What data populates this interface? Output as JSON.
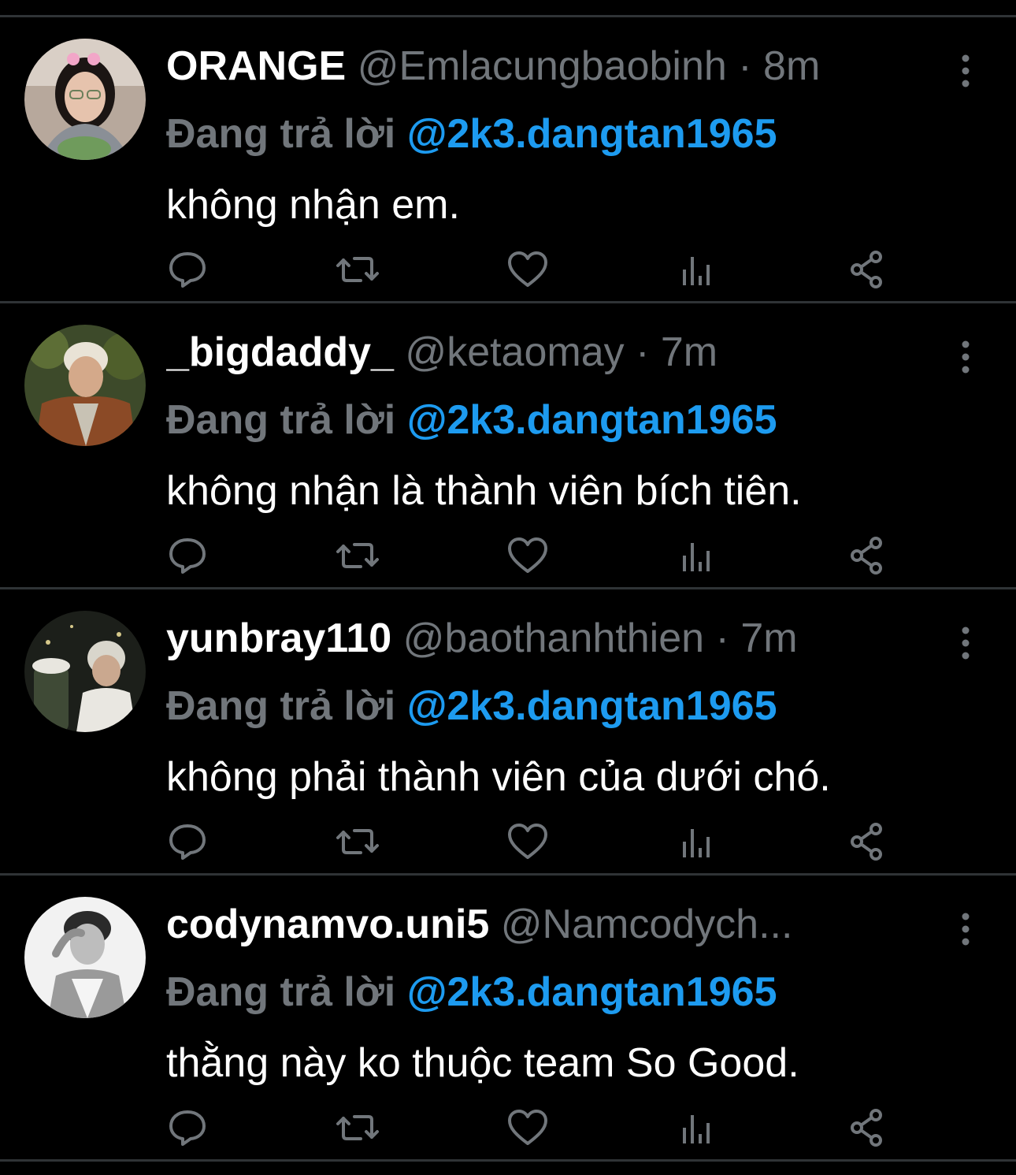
{
  "colors": {
    "background": "#000000",
    "divider": "#2f3336",
    "muted": "#71767b",
    "accent": "#1d9bf0",
    "text": "#ffffff"
  },
  "icons": {
    "reply": "reply-icon",
    "retweet": "retweet-icon",
    "like": "heart-icon",
    "views": "views-icon",
    "share": "share-icon",
    "more": "more-options-icon"
  },
  "tweets": [
    {
      "display_name": "ORANGE",
      "handle": "@Emlacungbaobinh",
      "separator": "·",
      "time": "8m",
      "reply_prefix": "Đang trả lời",
      "reply_to": "@2k3.dangtan1965",
      "text": "không nhận em."
    },
    {
      "display_name": "_bigdaddy_",
      "handle": "@ketaomay",
      "separator": "·",
      "time": "7m",
      "reply_prefix": "Đang trả lời",
      "reply_to": "@2k3.dangtan1965",
      "text": "không nhận là thành viên bích tiên."
    },
    {
      "display_name": "yunbray110",
      "handle": "@baothanhthien",
      "separator": "·",
      "time": "7m",
      "reply_prefix": "Đang trả lời",
      "reply_to": "@2k3.dangtan1965",
      "text": "không phải thành viên của dưới chó."
    },
    {
      "display_name": "codynamvo.uni5",
      "handle": "@Namcodych...",
      "reply_prefix": "Đang trả lời",
      "reply_to": "@2k3.dangtan1965",
      "text": "thằng này ko thuộc team So Good."
    }
  ]
}
